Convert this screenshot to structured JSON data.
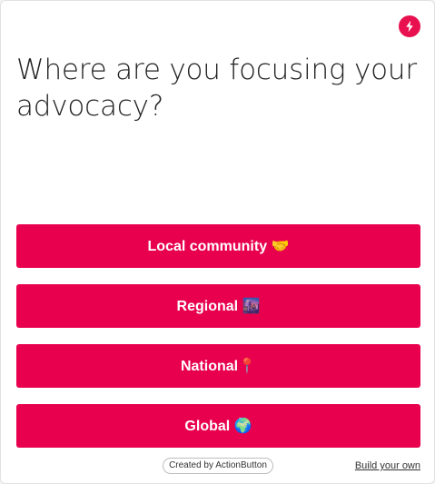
{
  "app": {
    "brand_icon": "lightning-bolt-icon",
    "accent_color": "#e8004e"
  },
  "question": {
    "text": "Where are you focusing your advocacy?"
  },
  "options": [
    {
      "label": "Local community 🤝"
    },
    {
      "label": "Regional 🌆"
    },
    {
      "label": "National📍"
    },
    {
      "label": "Global 🌍"
    }
  ],
  "footer": {
    "credit": "Created by ActionButton",
    "build_link": "Build your own"
  }
}
